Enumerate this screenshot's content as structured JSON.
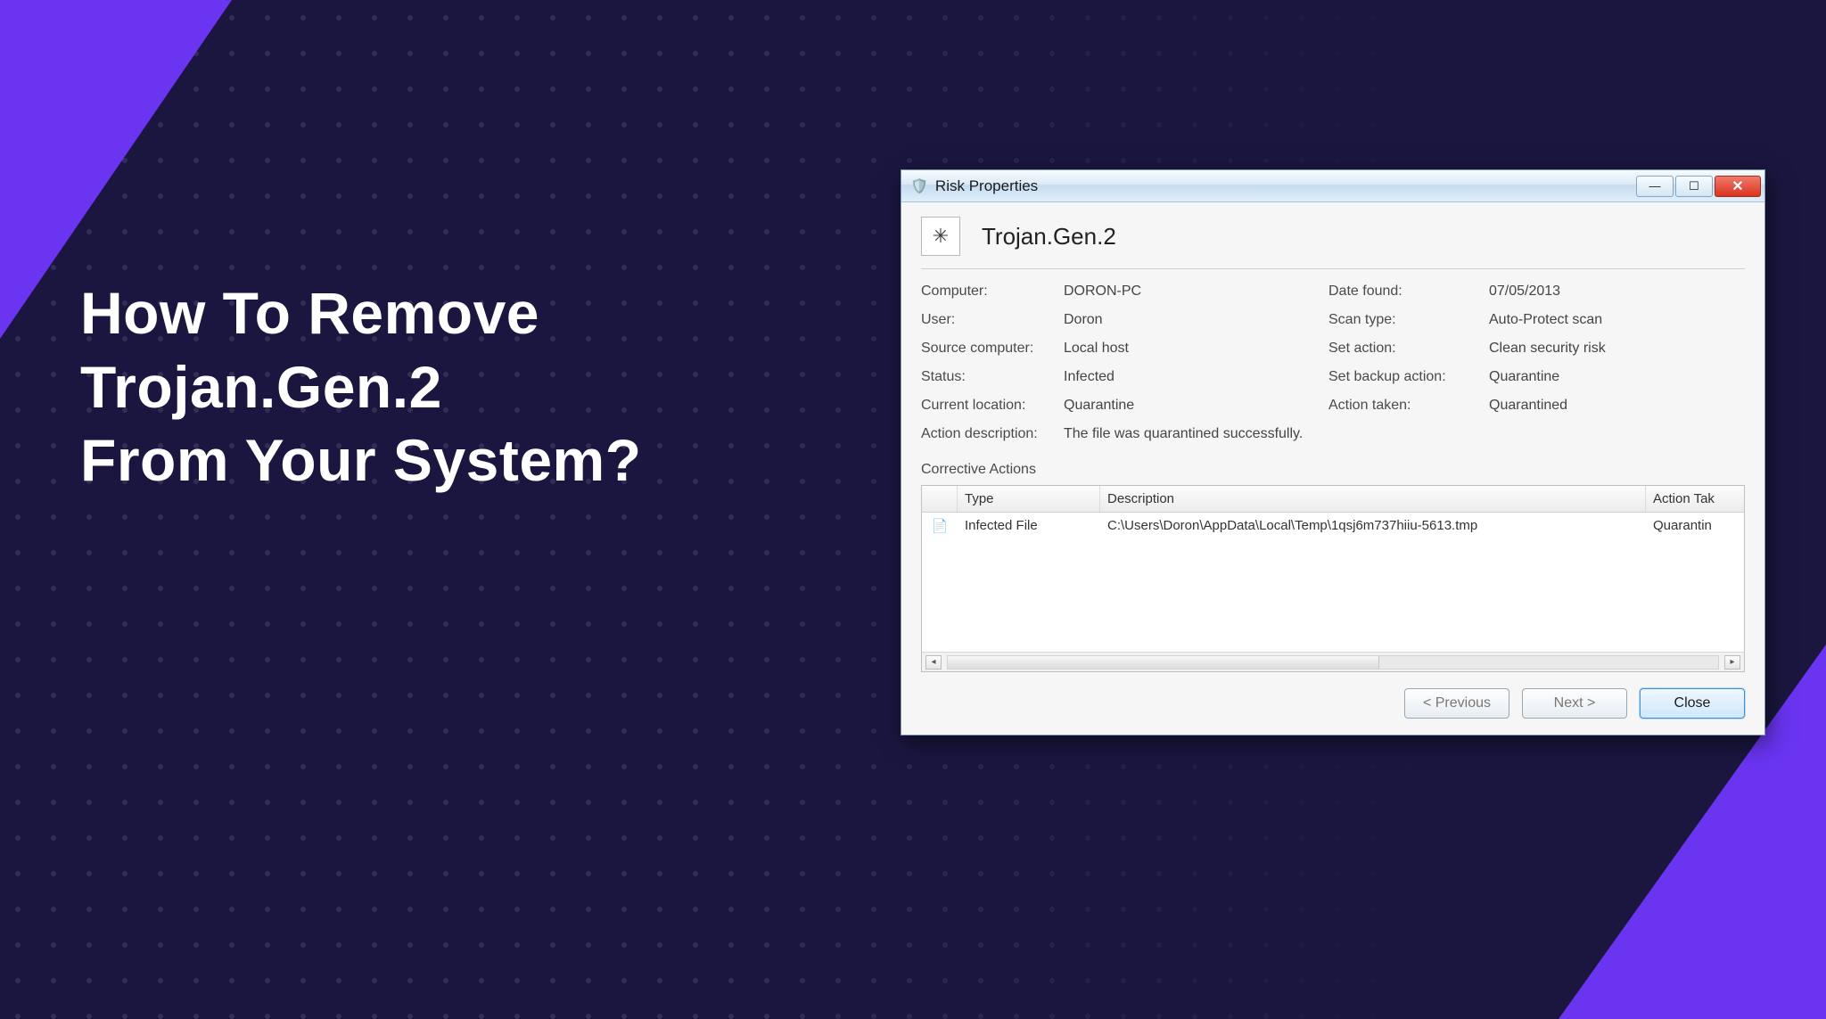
{
  "headline": {
    "line1": "How To Remove",
    "line2": "Trojan.Gen.2",
    "line3": "From Your System?"
  },
  "dialog": {
    "title": "Risk Properties",
    "threat_name": "Trojan.Gen.2",
    "fields": {
      "computer_label": "Computer:",
      "computer_value": "DORON-PC",
      "user_label": "User:",
      "user_value": "Doron",
      "source_label": "Source computer:",
      "source_value": "Local host",
      "status_label": "Status:",
      "status_value": "Infected",
      "location_label": "Current location:",
      "location_value": "Quarantine",
      "date_label": "Date found:",
      "date_value": "07/05/2013",
      "scan_label": "Scan type:",
      "scan_value": "Auto-Protect scan",
      "setaction_label": "Set action:",
      "setaction_value": "Clean security risk",
      "backup_label": "Set backup action:",
      "backup_value": "Quarantine",
      "taken_label": "Action taken:",
      "taken_value": "Quarantined",
      "desc_label": "Action description:",
      "desc_value": "The file was quarantined successfully."
    },
    "corrective_label": "Corrective Actions",
    "table": {
      "headers": {
        "type": "Type",
        "description": "Description",
        "action": "Action Tak"
      },
      "rows": [
        {
          "type": "Infected File",
          "description": "C:\\Users\\Doron\\AppData\\Local\\Temp\\1qsj6m737hiiu-5613.tmp",
          "action": "Quarantin"
        }
      ]
    },
    "buttons": {
      "prev": "< Previous",
      "next": "Next >",
      "close": "Close"
    }
  }
}
